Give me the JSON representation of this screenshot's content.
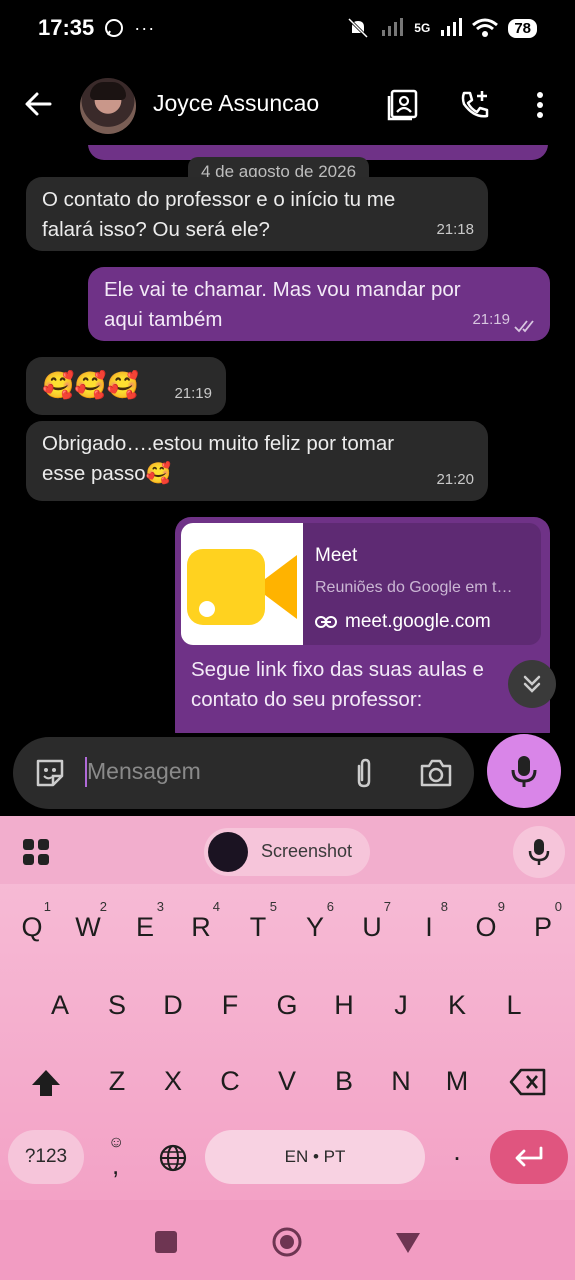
{
  "status_bar": {
    "time": "17:35",
    "network": "5G",
    "battery": "78"
  },
  "header": {
    "contact_name": "Joyce Assuncao"
  },
  "chat": {
    "date_separator": "4 de agosto de 2026",
    "messages": [
      {
        "direction": "in",
        "text_line1": "O contato do professor e o início tu me",
        "text_line2": "falará isso? Ou será ele?",
        "time": "21:18"
      },
      {
        "direction": "out",
        "text_line1": "Ele vai te chamar. Mas vou mandar por",
        "text_line2": "aqui também",
        "time": "21:19"
      },
      {
        "direction": "in",
        "text_line1": "🥰🥰🥰",
        "time": "21:19"
      },
      {
        "direction": "in",
        "text_line1": "Obrigado….estou muito feliz por tomar",
        "text_line2": "esse passo🥰",
        "time": "21:20"
      },
      {
        "direction": "out",
        "text_line1": "Segue link fixo das suas aulas e",
        "text_line2": "contato do seu professor:"
      }
    ],
    "link_preview": {
      "title": "Meet",
      "description": "Reuniões do Google em t…",
      "url": "meet.google.com"
    }
  },
  "compose": {
    "placeholder": "Mensagem"
  },
  "keyboard": {
    "clipboard_chip": "Screenshot",
    "row1": [
      "Q",
      "W",
      "E",
      "R",
      "T",
      "Y",
      "U",
      "I",
      "O",
      "P"
    ],
    "row1_hints": [
      "1",
      "2",
      "3",
      "4",
      "5",
      "6",
      "7",
      "8",
      "9",
      "0"
    ],
    "row2": [
      "A",
      "S",
      "D",
      "F",
      "G",
      "H",
      "J",
      "K",
      "L"
    ],
    "row3": [
      "Z",
      "X",
      "C",
      "V",
      "B",
      "N",
      "M"
    ],
    "symbols_key": "?123",
    "comma_key": ",",
    "space_label": "EN • PT",
    "period_key": "."
  },
  "colors": {
    "outgoing_bubble": "#6f3287",
    "incoming_bubble": "#2a2a2a",
    "mic_button": "#d985e8",
    "keyboard_bg": "#f4adcd",
    "enter_key": "#e0557f"
  }
}
